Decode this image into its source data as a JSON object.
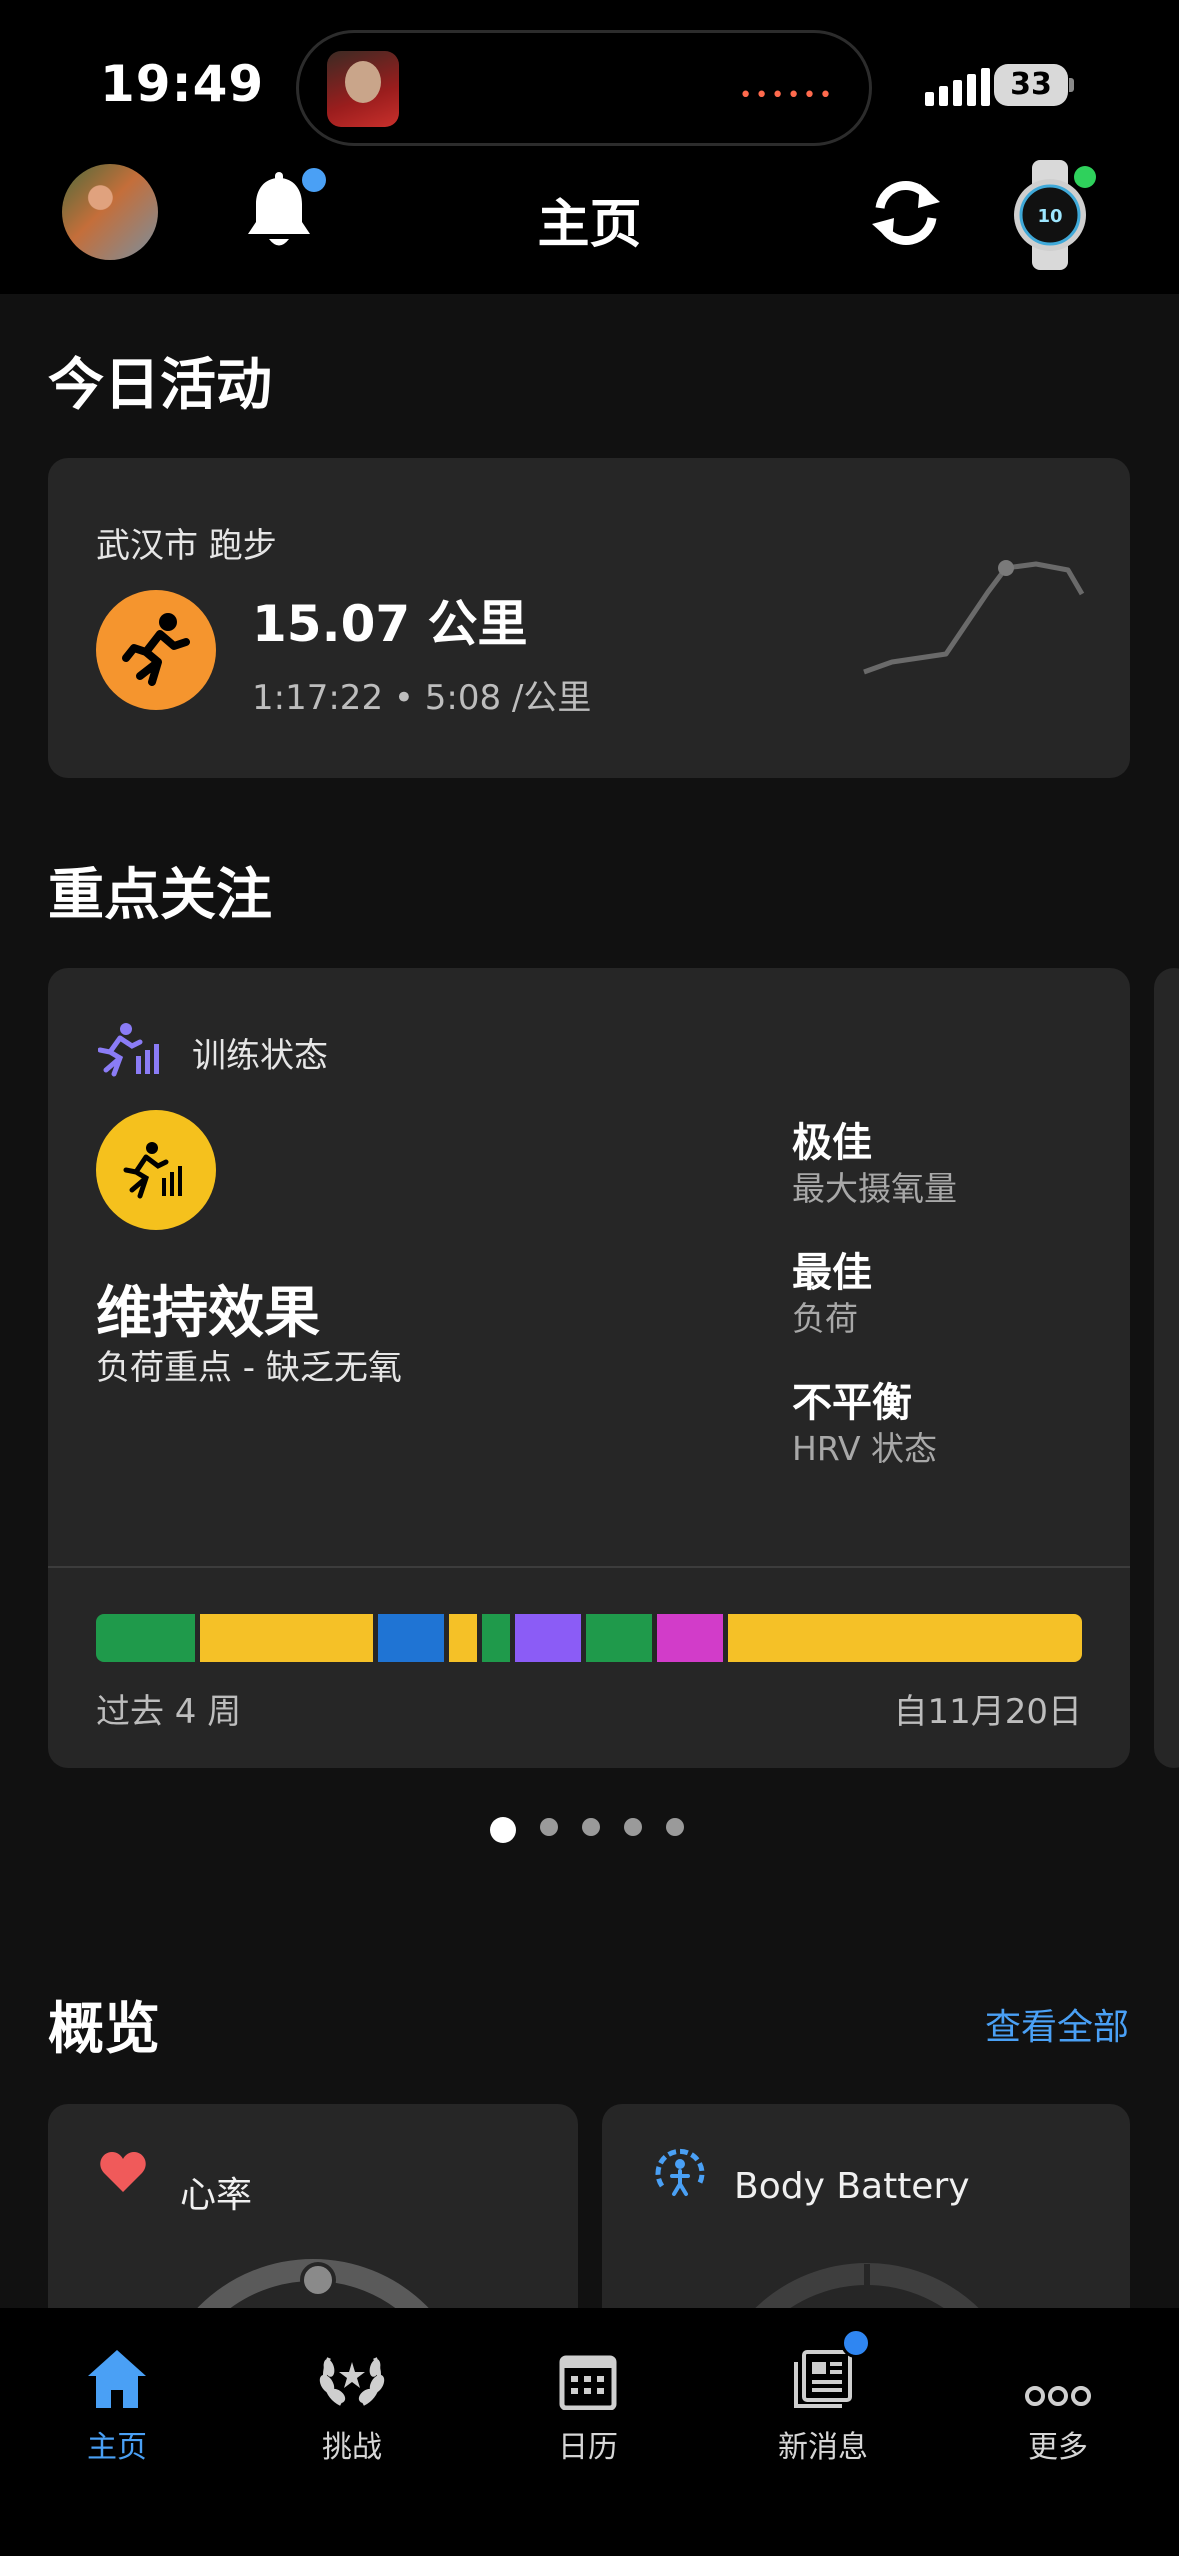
{
  "status_bar": {
    "time": "19:49",
    "battery": "33"
  },
  "header": {
    "title": "主页"
  },
  "today": {
    "section_title": "今日活动",
    "activity": {
      "location": "武汉市 跑步",
      "distance": "15.07 公里",
      "detail": "1:17:22 • 5:08 /公里",
      "icon": "running-icon",
      "accent": "#f5952e"
    }
  },
  "focus": {
    "section_title": "重点关注",
    "card": {
      "label": "训练状态",
      "headline": "维持效果",
      "subtitle": "负荷重点 - 缺乏无氧",
      "metrics": [
        {
          "value": "极佳",
          "label": "最大摄氧量"
        },
        {
          "value": "最佳",
          "label": "负荷"
        },
        {
          "value": "不平衡",
          "label": "HRV 状态"
        }
      ],
      "period_left": "过去 4 周",
      "period_right": "自11月20日",
      "bar_segments": [
        {
          "color": "#1f9a4b",
          "weight": 6
        },
        {
          "color": "#f5c127",
          "weight": 10.5
        },
        {
          "color": "#1f74d4",
          "weight": 4
        },
        {
          "color": "#f5c127",
          "weight": 1.7
        },
        {
          "color": "#1f9a4b",
          "weight": 1.7
        },
        {
          "color": "#8b5cf6",
          "weight": 4
        },
        {
          "color": "#1f9a4b",
          "weight": 4
        },
        {
          "color": "#d23cc9",
          "weight": 4
        },
        {
          "color": "#f5c127",
          "weight": 21.5
        }
      ]
    },
    "pager": {
      "count": 5,
      "active": 0
    }
  },
  "overview": {
    "section_title": "概览",
    "view_all": "查看全部",
    "cards": [
      {
        "title": "心率",
        "icon": "heart-icon",
        "accent": "#f05a5a"
      },
      {
        "title": "Body Battery",
        "icon": "body-battery-icon",
        "accent": "#4aa0f5"
      }
    ]
  },
  "bottom_nav": [
    {
      "label": "主页",
      "icon": "home-icon",
      "active": true
    },
    {
      "label": "挑战",
      "icon": "laurel-icon",
      "active": false
    },
    {
      "label": "日历",
      "icon": "calendar-icon",
      "active": false
    },
    {
      "label": "新消息",
      "icon": "newsfeed-icon",
      "active": false,
      "badge": true
    },
    {
      "label": "更多",
      "icon": "more-icon",
      "active": false
    }
  ]
}
